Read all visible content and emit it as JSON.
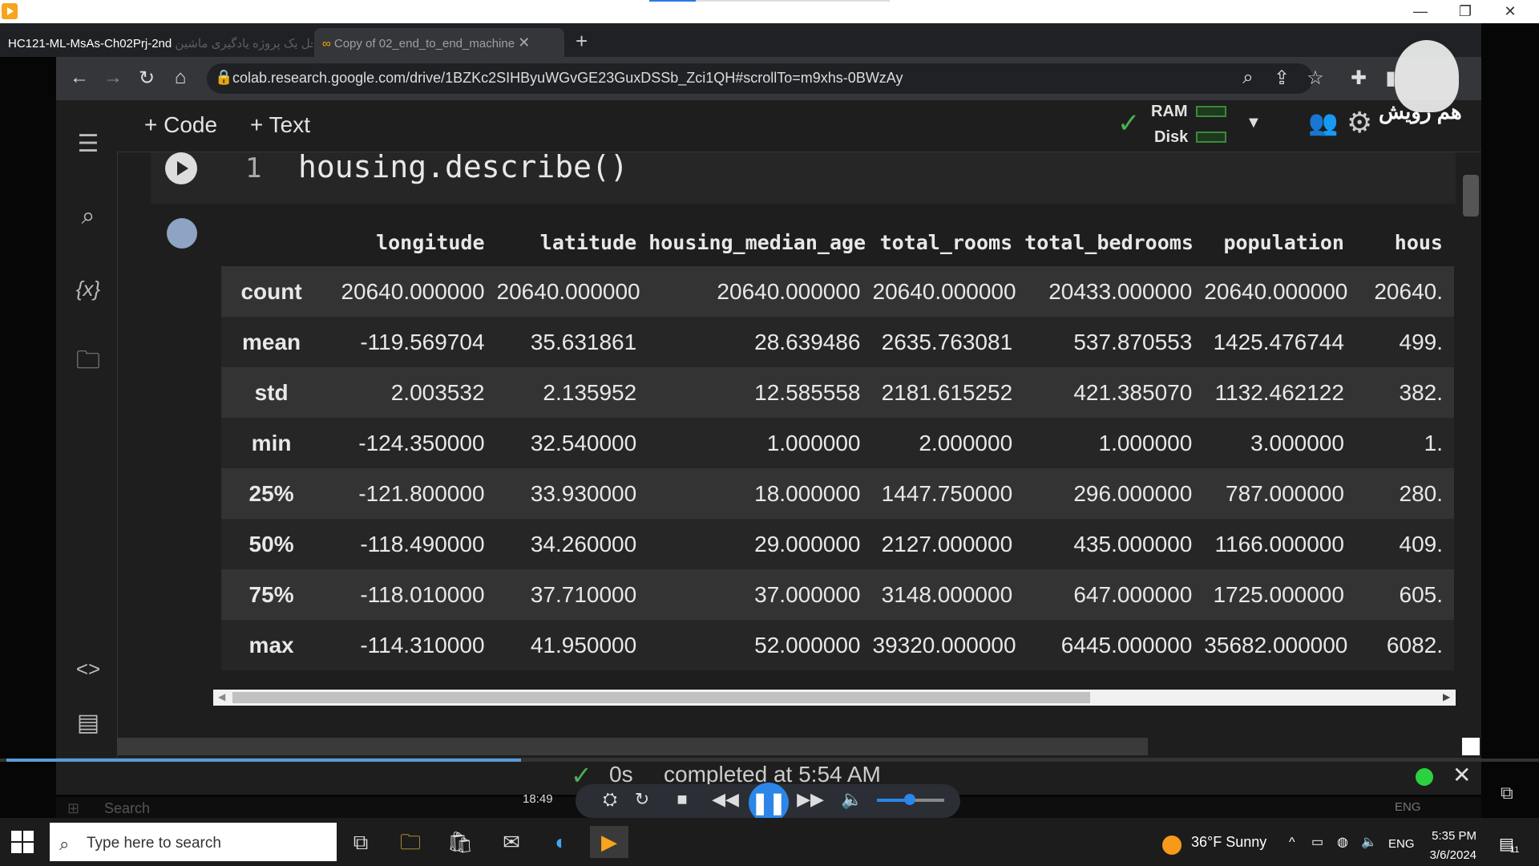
{
  "player": {
    "window_title": "HC121-ML-MsAs-Ch02Prj-2nd",
    "elapsed": "18:49"
  },
  "browser": {
    "tabs": [
      {
        "label": "مراحل یک پروژه یادگیری ماشین |"
      },
      {
        "label": "Copy of 02_end_to_end_machine"
      }
    ],
    "new_tab": "+",
    "url": "colab.research.google.com/drive/1BZKc2SIHByuWGvGE23GuxDSSb_Zci1QH#scrollTo=m9xhs-0BWzAy"
  },
  "colab": {
    "add_code": "+ Code",
    "add_text": "+ Text",
    "ram_label": "RAM",
    "disk_label": "Disk",
    "watermark": "هم رویش",
    "cell": {
      "line_number": "1",
      "code": "housing.describe()"
    },
    "table": {
      "columns": [
        "",
        "longitude",
        "latitude",
        "housing_median_age",
        "total_rooms",
        "total_bedrooms",
        "population",
        "hous"
      ],
      "rows": [
        [
          "count",
          "20640.000000",
          "20640.000000",
          "20640.000000",
          "20640.000000",
          "20433.000000",
          "20640.000000",
          "20640."
        ],
        [
          "mean",
          "-119.569704",
          "35.631861",
          "28.639486",
          "2635.763081",
          "537.870553",
          "1425.476744",
          "499."
        ],
        [
          "std",
          "2.003532",
          "2.135952",
          "12.585558",
          "2181.615252",
          "421.385070",
          "1132.462122",
          "382."
        ],
        [
          "min",
          "-124.350000",
          "32.540000",
          "1.000000",
          "2.000000",
          "1.000000",
          "3.000000",
          "1."
        ],
        [
          "25%",
          "-121.800000",
          "33.930000",
          "18.000000",
          "1447.750000",
          "296.000000",
          "787.000000",
          "280."
        ],
        [
          "50%",
          "-118.490000",
          "34.260000",
          "29.000000",
          "2127.000000",
          "435.000000",
          "1166.000000",
          "409."
        ],
        [
          "75%",
          "-118.010000",
          "37.710000",
          "37.000000",
          "3148.000000",
          "647.000000",
          "1725.000000",
          "605."
        ],
        [
          "max",
          "-114.310000",
          "41.950000",
          "52.000000",
          "39320.000000",
          "6445.000000",
          "35682.000000",
          "6082."
        ]
      ]
    },
    "status": {
      "duration": "0s",
      "text": "completed at 5:54 AM"
    }
  },
  "inner_taskbar": {
    "search": "Search",
    "lang": "ENG"
  },
  "taskbar": {
    "search_placeholder": "Type here to search",
    "weather": "36°F  Sunny",
    "lang": "ENG",
    "time": "5:35 PM",
    "date": "3/6/2024",
    "notification_count": "11"
  },
  "colors": {
    "accent": "#2c86e8",
    "status_ok": "#2bd13e"
  }
}
